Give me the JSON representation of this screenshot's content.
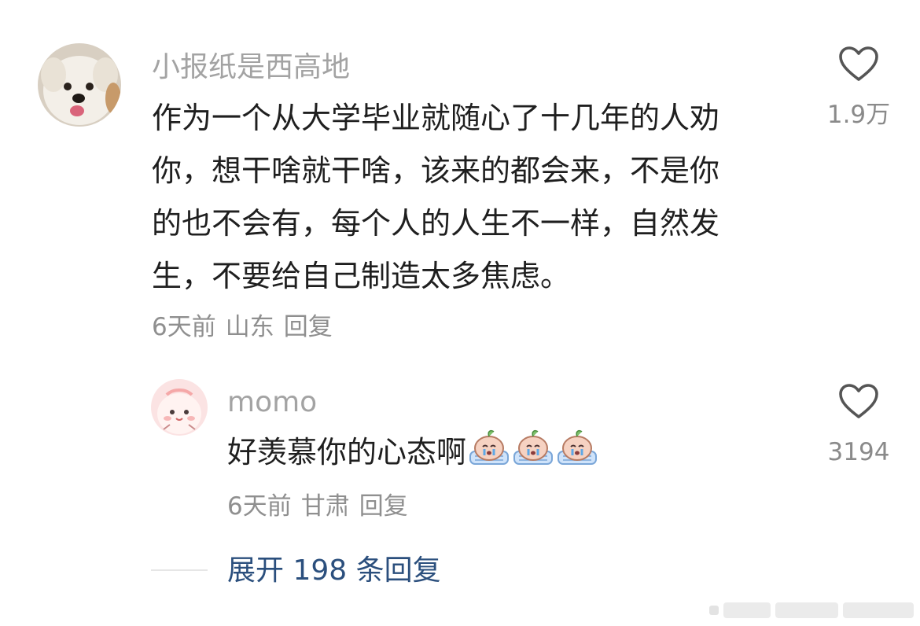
{
  "comment": {
    "username": "小报纸是西高地",
    "text_lines": [
      "作为一个从大学毕业就随心了十几年的人劝",
      "你，想干啥就干啥，该来的都会来，不是你",
      "的也不会有，每个人的人生不一样，自然发",
      "生，不要给自己制造太多焦虑。"
    ],
    "time": "6天前",
    "location": "山东",
    "reply_label": "回复",
    "like_count": "1.9万"
  },
  "reply": {
    "username": "momo",
    "text": "好羡慕你的心态啊",
    "emoji_count": 3,
    "time": "6天前",
    "location": "甘肃",
    "reply_label": "回复",
    "like_count": "3194"
  },
  "expand": {
    "label": "展开 198 条回复"
  },
  "colors": {
    "username": "#a3a3a3",
    "text": "#1f1f1f",
    "meta": "#8f8f8f",
    "link": "#2b4f7d",
    "heart_stroke": "#555555"
  },
  "icons": {
    "like": "heart-outline-icon",
    "emoji": "crying-peach-emoji"
  }
}
